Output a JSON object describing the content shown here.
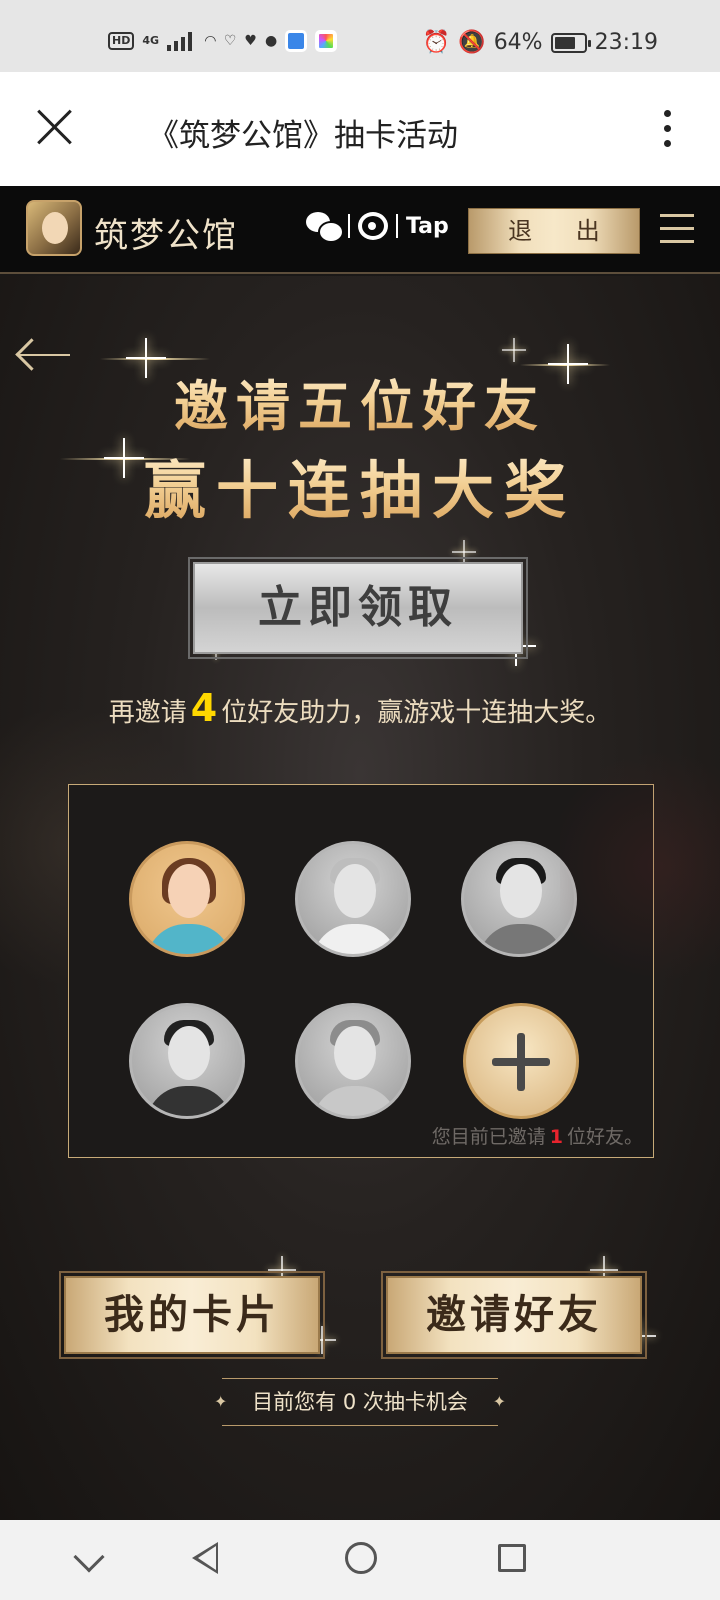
{
  "status_bar": {
    "network_badge": "HD",
    "network_type": "4G",
    "battery_percent": "64%",
    "time": "23:19",
    "icons": [
      "hd-icon",
      "signal-icon",
      "wifi-icon",
      "health-icon",
      "heart-icon",
      "chat-icon",
      "app-icon",
      "app-icon",
      "alarm-icon",
      "mute-icon",
      "battery-icon"
    ]
  },
  "browser": {
    "title": "《筑梦公馆》抽卡活动",
    "close_icon": "close-icon",
    "menu_icon": "more-vertical-icon"
  },
  "site_header": {
    "logo_text": "筑梦公馆",
    "social_tap": "Tap",
    "logout_label": "退 出",
    "menu_icon": "hamburger-icon"
  },
  "event": {
    "headline_1": "邀请五位好友",
    "headline_2": "赢十连抽大奖",
    "claim_label": "立即领取",
    "invite_prefix": "再邀请",
    "invite_remaining": "4",
    "invite_suffix": "位好友助力，赢游戏十连抽大奖。",
    "friends": [
      {
        "status": "invited"
      },
      {
        "status": "empty"
      },
      {
        "status": "empty"
      },
      {
        "status": "empty"
      },
      {
        "status": "empty"
      }
    ],
    "invited_prefix": "您目前已邀请",
    "invited_count": "1",
    "invited_suffix": "位好友。",
    "my_cards_label": "我的卡片",
    "invite_friends_label": "邀请好友",
    "chances_text": "目前您有 0 次抽卡机会"
  },
  "nav_bar": {
    "icons": [
      "chevron-down-icon",
      "back-icon",
      "home-icon",
      "recents-icon"
    ]
  },
  "colors": {
    "gold": "#f0c98a",
    "highlight_yellow": "#ffd800",
    "red": "#e8242e",
    "dark_bg": "#1a1817"
  }
}
